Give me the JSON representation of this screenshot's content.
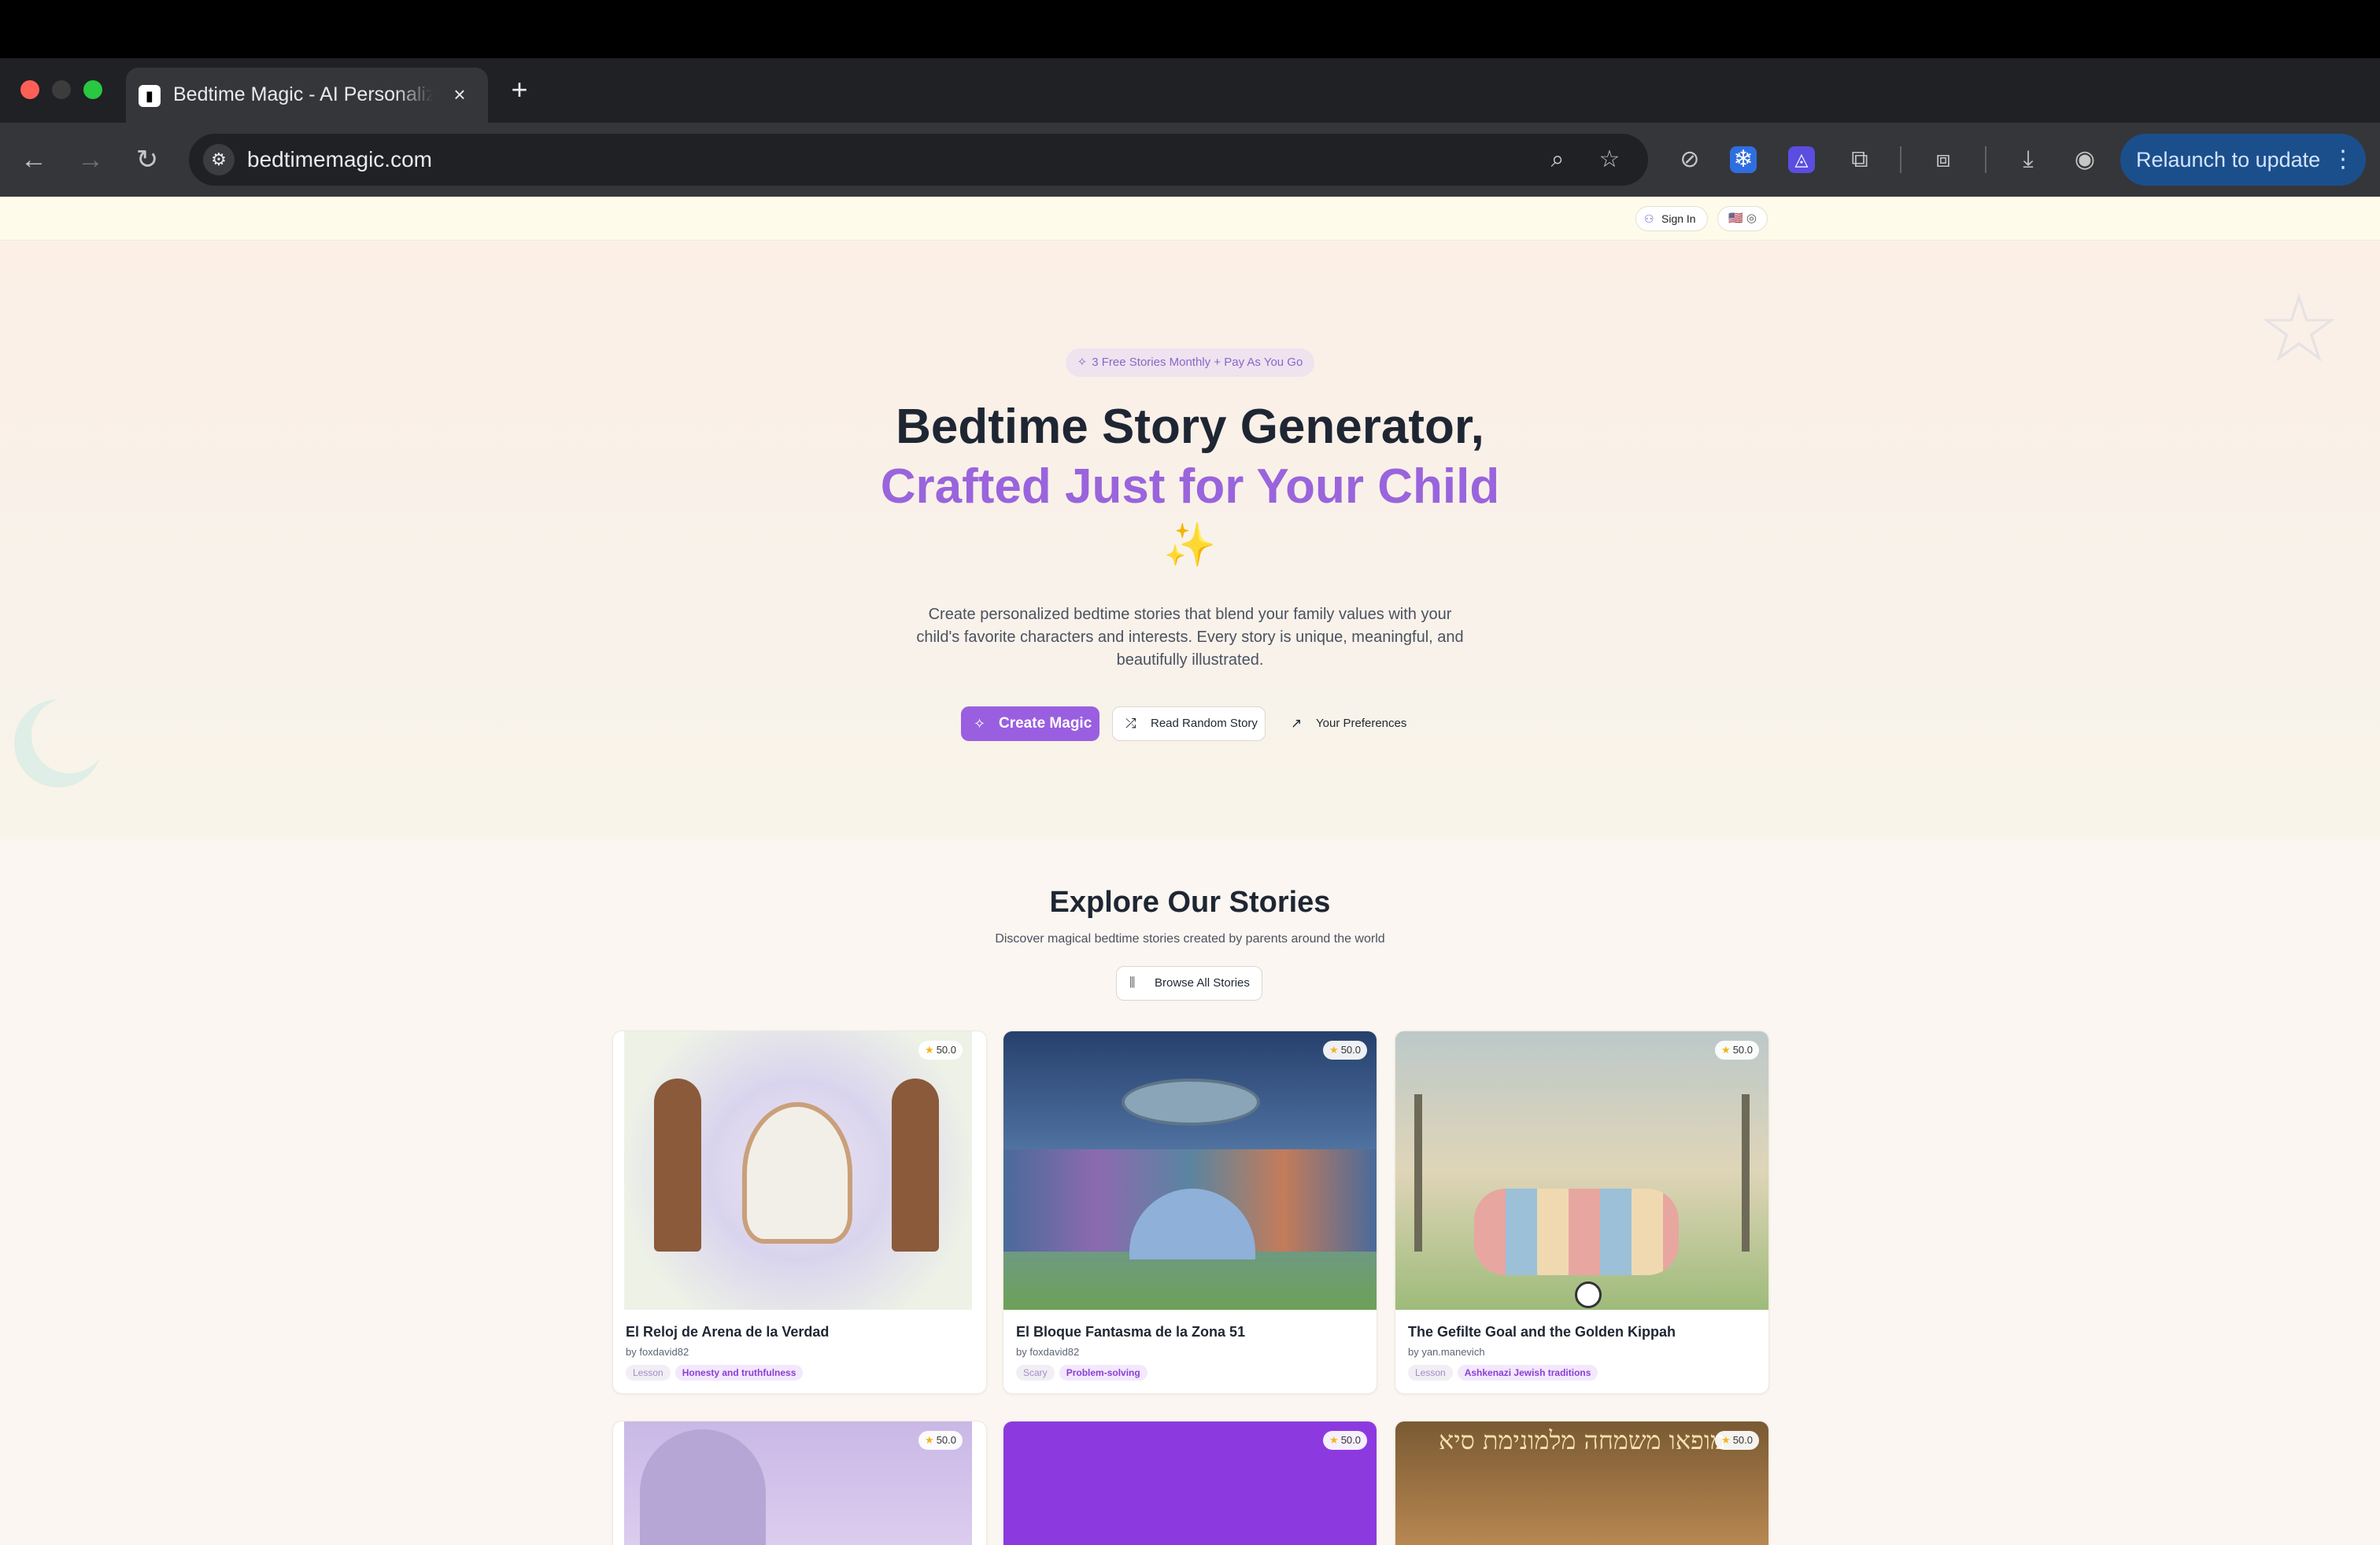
{
  "browser": {
    "tab_title": "Bedtime Magic - AI Personalized Bedtime Stories",
    "url": "bedtimemagic.com",
    "relaunch_label": "Relaunch to update"
  },
  "topnav": {
    "sign_in": "Sign In",
    "language": "🇺🇸 ◎"
  },
  "hero": {
    "promo": "3 Free Stories Monthly + Pay As You Go",
    "title_line1": "Bedtime Story Generator,",
    "title_line2": "Crafted Just for Your Child",
    "sparkle": "✨",
    "description": "Create personalized bedtime stories that blend your family values with your child's favorite characters and interests. Every story is unique, meaningful, and beautifully illustrated.",
    "buttons": {
      "create": "Create Magic",
      "random": "Read Random Story",
      "preferences": "Your Preferences"
    }
  },
  "explore": {
    "title": "Explore Our Stories",
    "subtitle": "Discover magical bedtime stories created by parents around the world",
    "browse": "Browse All Stories"
  },
  "stories": [
    {
      "title": "El Reloj de Arena de la Verdad",
      "author": "by foxdavid82",
      "rating": "50.0",
      "tags": [
        "Lesson",
        "Honesty and truthfulness"
      ]
    },
    {
      "title": "El Bloque Fantasma de la Zona 51",
      "author": "by foxdavid82",
      "rating": "50.0",
      "tags": [
        "Scary",
        "Problem-solving"
      ]
    },
    {
      "title": "The Gefilte Goal and the Golden Kippah",
      "author": "by yan.manevich",
      "rating": "50.0",
      "tags": [
        "Lesson",
        "Ashkenazi Jewish traditions"
      ]
    },
    {
      "rating": "50.0"
    },
    {
      "rating": "50.0"
    },
    {
      "rating": "50.0",
      "image_text": "מופאו משמחה מלמונימת סיא"
    }
  ],
  "colors": {
    "accent": "#9a5fe0",
    "title_accent": "#9a64dc",
    "relaunch": "#1b4f8c"
  }
}
